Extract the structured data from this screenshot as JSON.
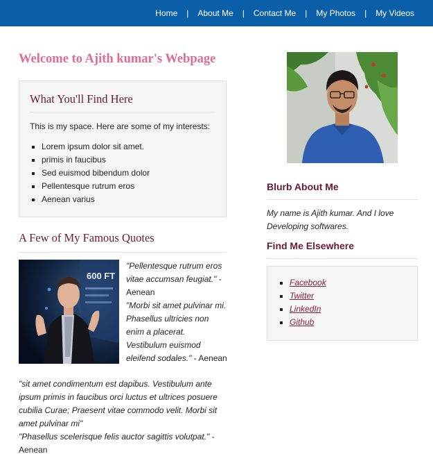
{
  "nav": {
    "items": [
      "Home",
      "About Me",
      "Contact Me",
      "My Photos",
      "My Videos"
    ],
    "separator": "|"
  },
  "welcome": "Welcome to Ajith kumar's Webpage",
  "find": {
    "title": "What You'll Find Here",
    "intro": "This is my space. Here are some of my interests:",
    "items": [
      "Lorem ipsum dolor sit amet.",
      "primis in faucibus",
      "Sed euismod bibendum dolor",
      "Pellentesque rutrum eros",
      "Aenean varius"
    ]
  },
  "quotes": {
    "title": "A Few of My Famous Quotes",
    "q1": "\"Pellentesque rutrum eros vitae accumsan feugiat.\"",
    "q1_author": "- Aenean",
    "q2": "\"Morbi sit amet pulvinar mi. Phasellus ultricies non enim a placerat. Vestibulum euismod eleifend sodales.\"",
    "q2_author": "- Aenean",
    "q3": "\"sit amet condimentum est dapibus. Vestibulum ante ipsum primis in faucibus orci luctus et ultrices posuere cubilia Curae; Praesent vitae commodo velit. Morbi sit amet pulvinar mi\"",
    "q4": "\"Phasellus scelerisque felis auctor sagittis volutpat.\"",
    "q4_author": "- Aenean",
    "photo_text": "600 FT"
  },
  "blurb": {
    "title": "Blurb About Me",
    "text": "My name is Ajith kumar. And I love Developing softwares."
  },
  "elsewhere": {
    "title": "Find Me Elsewhere",
    "links": [
      "Facebook",
      "Twitter",
      "LinkedIn",
      "Github"
    ]
  },
  "colors": {
    "topbar": "#0b5fa8",
    "welcome": "#e06b93",
    "heading": "#6b1a33",
    "link": "#8a1e3c"
  }
}
